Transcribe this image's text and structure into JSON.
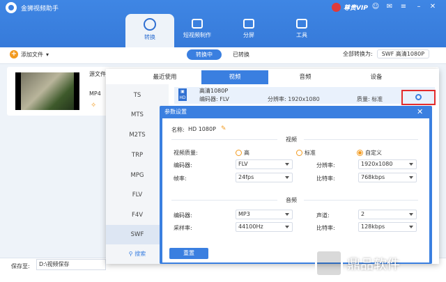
{
  "app": {
    "title": "金狮视频助手",
    "vip": "尊贵VIP"
  },
  "nav": {
    "tabs": [
      {
        "label": "转换"
      },
      {
        "label": "短视频制作"
      },
      {
        "label": "分屏"
      },
      {
        "label": "工具"
      }
    ]
  },
  "toolbar": {
    "add_label": "添加文件",
    "seg_active": "转换中",
    "seg_other": "已转换",
    "convert_all_label": "全部转换为:",
    "convert_all_value": "SWF 高清1080P"
  },
  "file": {
    "source_label": "源文件",
    "format": "MP4"
  },
  "bottom": {
    "save_label": "保存至:",
    "save_path": "D:\\视频保存"
  },
  "panel": {
    "tabs": [
      "最近使用",
      "视频",
      "音频",
      "设备"
    ],
    "formats": [
      "TS",
      "MTS",
      "M2TS",
      "TRP",
      "MPG",
      "FLV",
      "F4V",
      "SWF"
    ],
    "search_label": "搜索",
    "preset": {
      "title": "高清1080P",
      "encoder": "编码器: FLV",
      "resolution": "分辨率: 1920x1080",
      "quality": "质量: 标准"
    }
  },
  "dialog": {
    "title": "参数设置",
    "name_label": "名称:",
    "name_value": "HD 1080P",
    "video_section": "视频",
    "audio_section": "音频",
    "quality_label": "视频质量:",
    "quality_options": [
      "高",
      "标准",
      "自定义"
    ],
    "video": {
      "encoder_label": "编码器:",
      "encoder": "FLV",
      "resolution_label": "分辨率:",
      "resolution": "1920x1080",
      "fps_label": "帧率:",
      "fps": "24fps",
      "bitrate_label": "比特率:",
      "bitrate": "768kbps"
    },
    "audio": {
      "encoder_label": "编码器:",
      "encoder": "MP3",
      "channel_label": "声道:",
      "channel": "2",
      "samplerate_label": "采样率:",
      "samplerate": "44100Hz",
      "bitrate_label": "比特率:",
      "bitrate": "128kbps"
    },
    "reset_label": "重置"
  },
  "watermark": {
    "text": "鼎品软件"
  }
}
